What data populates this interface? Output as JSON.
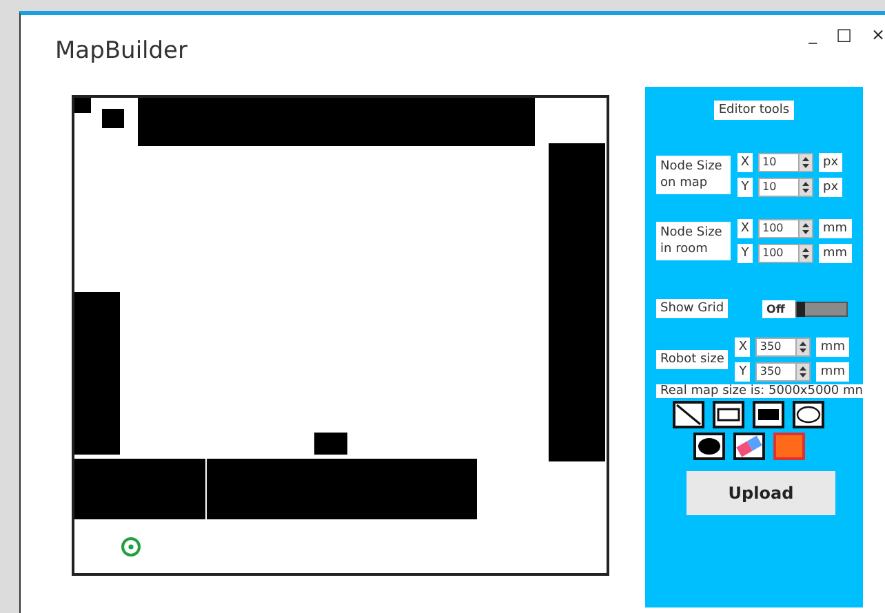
{
  "window": {
    "title": "MapBuilder",
    "controls": [
      "_",
      "□",
      "×"
    ]
  },
  "editor": {
    "title": "Editor tools",
    "groups": [
      {
        "label": "Node Size on map",
        "rows": [
          {
            "axis": "X",
            "value": "10",
            "unit": "px"
          },
          {
            "axis": "Y",
            "value": "10",
            "unit": "px"
          }
        ]
      },
      {
        "label": "Node Size in room",
        "rows": [
          {
            "axis": "X",
            "value": "100",
            "unit": "mm"
          },
          {
            "axis": "Y",
            "value": "100",
            "unit": "mm"
          }
        ]
      }
    ],
    "show_grid": {
      "label": "Show Grid",
      "state_text": "Off",
      "on": false
    },
    "robot_size": {
      "label": "Robot size",
      "rows": [
        {
          "axis": "X",
          "value": "350",
          "unit": "mm"
        },
        {
          "axis": "Y",
          "value": "350",
          "unit": "mm"
        }
      ]
    },
    "real_size": "Real map size is: 5000x5000 mn",
    "tools": [
      {
        "kind": "line"
      },
      {
        "kind": "rect"
      },
      {
        "kind": "filled-rect"
      },
      {
        "kind": "ellipse"
      },
      {
        "kind": "filled-ellipse"
      },
      {
        "kind": "eraser"
      },
      {
        "kind": "color",
        "color": "#ff6a1a"
      }
    ],
    "upload": "Upload"
  }
}
